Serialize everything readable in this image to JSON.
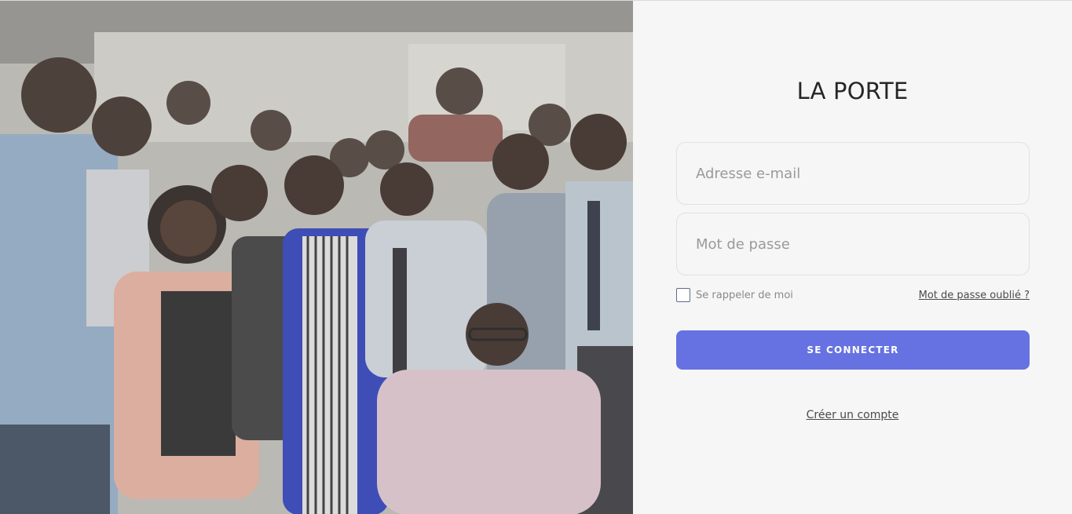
{
  "brand": {
    "title": "LA PORTE"
  },
  "photo": {
    "description_icon": "group-photo",
    "background_color": "#b8b6b2"
  },
  "form": {
    "email_placeholder": "Adresse e-mail",
    "password_placeholder": "Mot de passe",
    "remember_label": "Se rappeler de moi",
    "remember_checked": false,
    "forgot_label": "Mot de passe oublié ?",
    "submit_label": "SE CONNECTER",
    "create_account_label": "Créer un compte"
  },
  "colors": {
    "accent": "#6672e1",
    "panel_background": "#f6f6f6",
    "title": "#262626",
    "placeholder": "#9a9a9a"
  }
}
